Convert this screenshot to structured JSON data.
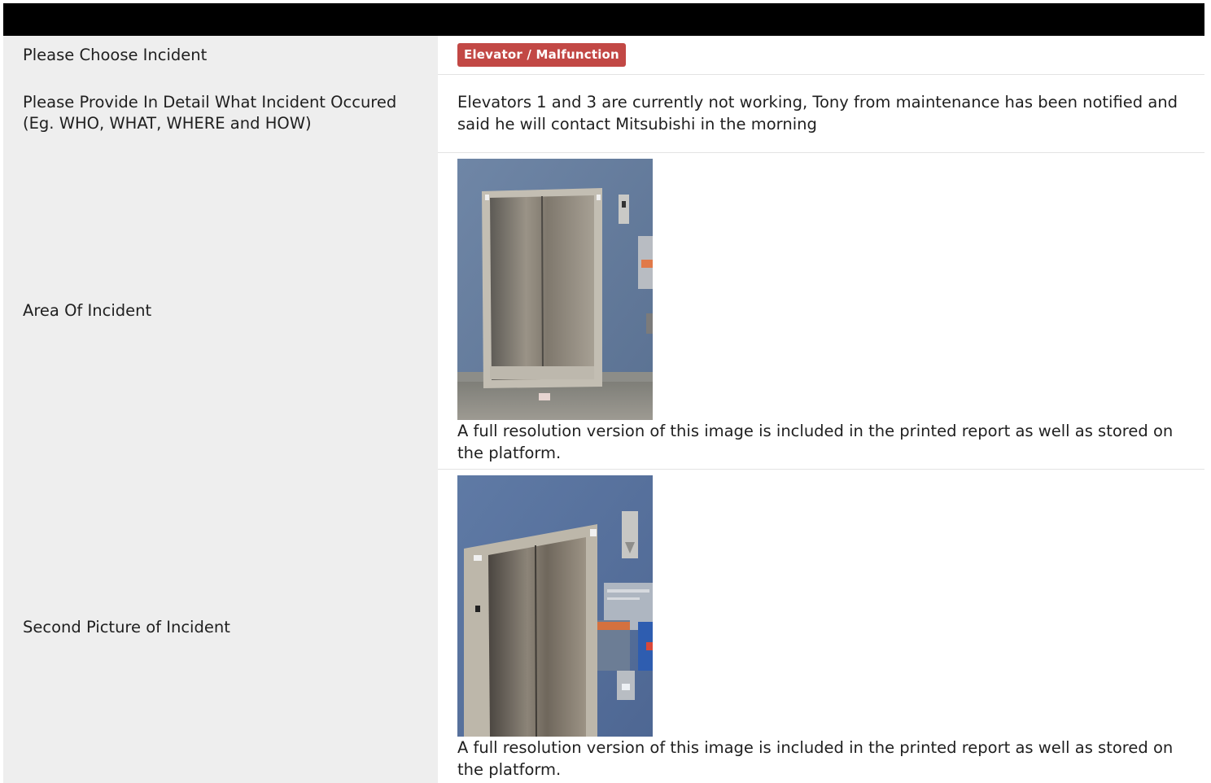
{
  "incident": {
    "label": "Please Choose Incident",
    "value": "Elevator / Malfunction"
  },
  "detail": {
    "label": "Please Provide In Detail What Incident Occured (Eg. WHO, WHAT, WHERE and HOW)",
    "value": "Elevators 1 and 3 are currently not working, Tony from maintenance has been notified and said he will contact Mitsubishi in the morning"
  },
  "area": {
    "label": "Area Of Incident",
    "caption": "A full resolution version of this image is included in the printed report as well as stored on the platform."
  },
  "second": {
    "label": "Second Picture of Incident",
    "caption": "A full resolution version of this image is included in the printed report as well as stored on the platform."
  },
  "colors": {
    "header": "#000000",
    "badge": "#c24845",
    "label_bg": "#eeeeee"
  }
}
